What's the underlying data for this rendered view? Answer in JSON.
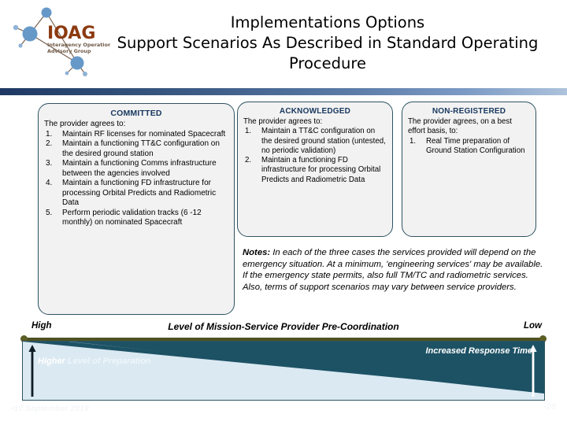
{
  "logo": {
    "wordmark": "IOAG",
    "tagline_line1": "Interagency Operations",
    "tagline_line2": "Advisory Group"
  },
  "title": {
    "line1": "Implementations Options",
    "line2": "Support Scenarios As Described in Standard Operating",
    "line3": "Procedure"
  },
  "boxes": [
    {
      "heading": "COMMITTED",
      "intro": "The provider agrees to:",
      "items": [
        {
          "num": "1.",
          "text": "Maintain RF licenses for nominated Spacecraft"
        },
        {
          "num": "2.",
          "text": "Maintain a functioning TT&C configuration on the desired ground station"
        },
        {
          "num": "3.",
          "text": "Maintain a functioning Comms infrastructure between the agencies involved"
        },
        {
          "num": "4.",
          "text": "Maintain a functioning FD infrastructure for processing Orbital Predicts and Radiometric Data"
        },
        {
          "num": "5.",
          "text": "Perform periodic validation tracks (6 -12 monthly) on nominated Spacecraft"
        }
      ]
    },
    {
      "heading": "ACKNOWLEDGED",
      "intro": "The provider agrees to:",
      "items": [
        {
          "num": "1.",
          "text": "Maintain a TT&C configuration on the desired ground station (untested, no periodic validation)"
        },
        {
          "num": "2.",
          "text": "Maintain a functioning FD infrastructure for processing Orbital Predicts and Radiometric Data"
        }
      ]
    },
    {
      "heading": "NON-REGISTERED",
      "intro": "The provider agrees, on a best effort basis, to:",
      "items": [
        {
          "num": "1.",
          "text": "Real Time preparation of Ground Station Configuration"
        }
      ]
    }
  ],
  "notes": {
    "label": "Notes:",
    "body": " In each of the three cases the services provided will depend on the emergency situation. At a minimum, 'engineering services' may be available. If the emergency state permits, also full TM/TC and radiometric services. Also, terms of support scenarios may vary between service providers."
  },
  "axis": {
    "left_label": "High",
    "right_label": "Low",
    "title": "Level of Mission-Service Provider Pre-Coordination",
    "line_color": "#4f5122"
  },
  "wedge": {
    "left_text_emphasis": "Higher",
    "left_text_rest": " Level of Preparation",
    "right_text": "Increased Response Time",
    "dark_color": "#1d5265",
    "light_color": "#dbe9f2"
  },
  "footer": {
    "date": "•17 September 2019",
    "page": "•28"
  }
}
